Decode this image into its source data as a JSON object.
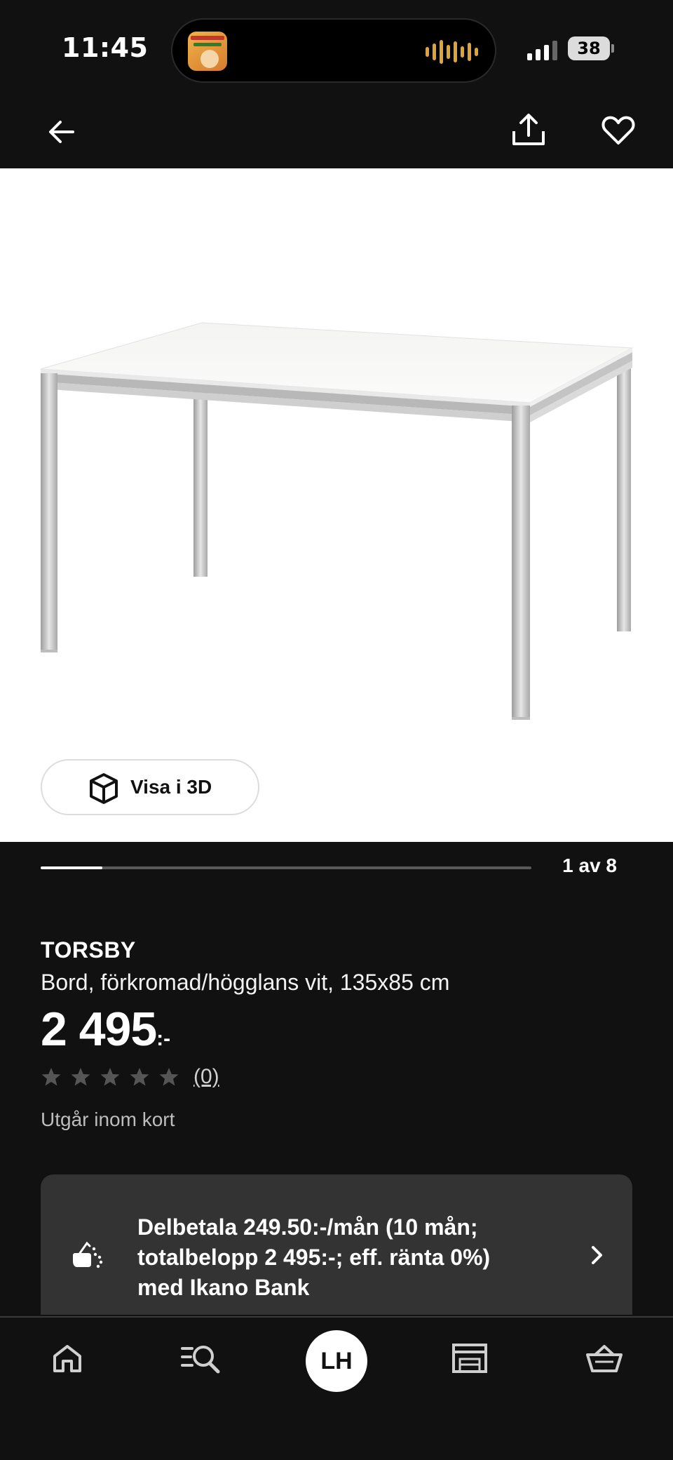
{
  "status_bar": {
    "time": "11:45",
    "battery": "38",
    "album_art_icon": "album-art-icon",
    "audio_wave_icon": "waveform-icon"
  },
  "header": {
    "back_icon": "arrow-left-icon",
    "share_icon": "share-icon",
    "favorite_icon": "heart-icon"
  },
  "gallery": {
    "view_3d_label": "Visa i 3D",
    "counter": "1 av 8",
    "current_index": 1,
    "total": 8,
    "progress_fraction": 0.125
  },
  "product": {
    "name": "TORSBY",
    "description": "Bord, förkromad/högglans vit, 135x85 cm",
    "price": "2 495",
    "price_suffix": ":-",
    "rating_stars": 0,
    "rating_max": 5,
    "review_count": "(0)",
    "availability": "Utgår inom kort"
  },
  "financing": {
    "text": "Delbetala 249.50:-/mån (10 mån; totalbelopp 2 495:-; eff. ränta 0%) med Ikano Bank",
    "icon": "installment-icon"
  },
  "bottom_nav": {
    "home_icon": "home-icon",
    "search_icon": "search-list-icon",
    "profile_initials": "LH",
    "store_icon": "store-icon",
    "cart_icon": "basket-icon"
  },
  "colors": {
    "background": "#111111",
    "card": "#333333",
    "image_bg": "#ffffff",
    "text": "#ffffff",
    "muted_text": "#bdbdbd",
    "star": "#555555"
  }
}
